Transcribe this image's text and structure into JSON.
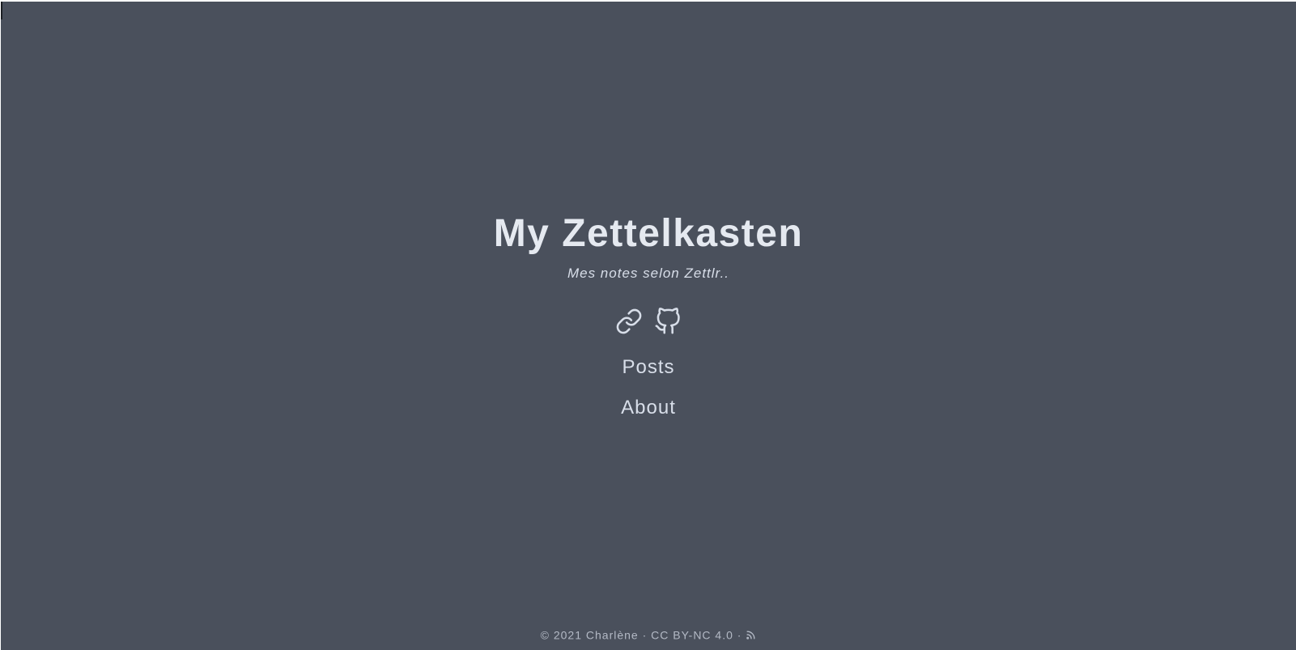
{
  "site": {
    "title": "My Zettelkasten",
    "subtitle": "Mes notes selon Zettlr.."
  },
  "social_links": [
    {
      "icon": "link-icon",
      "label": "link"
    },
    {
      "icon": "github-icon",
      "label": "GitHub"
    }
  ],
  "nav": {
    "items": [
      {
        "label": "Posts"
      },
      {
        "label": "About"
      }
    ]
  },
  "footer": {
    "copyright": "© 2021 Charlène",
    "separator": "·",
    "license": "CC BY-NC 4.0",
    "rss_icon": "rss-icon"
  },
  "colors": {
    "background": "#4a505c",
    "title": "#e5e9f0",
    "text": "#d8dee9",
    "footer_text": "#b3b9c5"
  }
}
